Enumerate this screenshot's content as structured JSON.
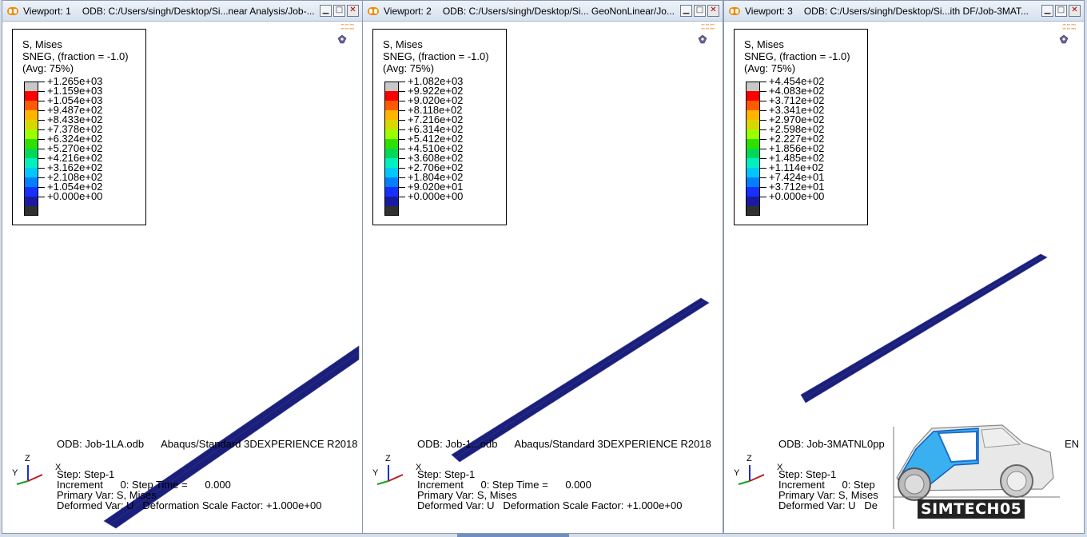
{
  "colors": {
    "scale": [
      "#c8c8c8",
      "#ff0000",
      "#ff5a00",
      "#ffb400",
      "#d8d800",
      "#9cff00",
      "#2ee000",
      "#00d85a",
      "#00f0c0",
      "#00c8ff",
      "#0080ff",
      "#1830ff",
      "#1a1aa0",
      "#303030"
    ],
    "mesh": "#1b1f7a",
    "mesh_line": "#3a4aa8"
  },
  "viewports": [
    {
      "title": "Viewport: 1",
      "odb_path": "ODB: C:/Users/singh/Desktop/Si...near Analysis/Job-...",
      "legend": {
        "header": [
          "S, Mises",
          "SNEG, (fraction = -1.0)",
          "(Avg: 75%)"
        ],
        "values": [
          "+1.265e+03",
          "+1.159e+03",
          "+1.054e+03",
          "+9.487e+02",
          "+8.433e+02",
          "+7.378e+02",
          "+6.324e+02",
          "+5.270e+02",
          "+4.216e+02",
          "+3.162e+02",
          "+2.108e+02",
          "+1.054e+02",
          "+0.000e+00"
        ]
      },
      "info": {
        "odb_line": "ODB: Job-1LA.odb      Abaqus/Standard 3DEXPERIENCE R2018",
        "step": "Step: Step-1",
        "increment": "Increment      0: Step Time =      0.000",
        "primary": "Primary Var: S, Mises",
        "deformed": "Deformed Var: U   Deformation Scale Factor: +1.000e+00"
      }
    },
    {
      "title": "Viewport: 2",
      "odb_path": "ODB: C:/Users/singh/Desktop/Si... GeoNonLinear/Jo...",
      "legend": {
        "header": [
          "S, Mises",
          "SNEG, (fraction = -1.0)",
          "(Avg: 75%)"
        ],
        "values": [
          "+1.082e+03",
          "+9.922e+02",
          "+9.020e+02",
          "+8.118e+02",
          "+7.216e+02",
          "+6.314e+02",
          "+5.412e+02",
          "+4.510e+02",
          "+3.608e+02",
          "+2.706e+02",
          "+1.804e+02",
          "+9.020e+01",
          "+0.000e+00"
        ]
      },
      "info": {
        "odb_line": "ODB: Job-1...odb      Abaqus/Standard 3DEXPERIENCE R2018",
        "step": "Step: Step-1",
        "increment": "Increment      0: Step Time =      0.000",
        "primary": "Primary Var: S, Mises",
        "deformed": "Deformed Var: U   Deformation Scale Factor: +1.000e+00"
      }
    },
    {
      "title": "Viewport: 3",
      "odb_path": "ODB: C:/Users/singh/Desktop/Si...ith DF/Job-3MAT...",
      "legend": {
        "header": [
          "S, Mises",
          "SNEG, (fraction = -1.0)",
          "(Avg: 75%)"
        ],
        "values": [
          "+4.454e+02",
          "+4.083e+02",
          "+3.712e+02",
          "+3.341e+02",
          "+2.970e+02",
          "+2.598e+02",
          "+2.227e+02",
          "+1.856e+02",
          "+1.485e+02",
          "+1.114e+02",
          "+7.424e+01",
          "+3.712e+01",
          "+0.000e+00"
        ]
      },
      "info": {
        "odb_line": "ODB: Job-3MATNL0pp",
        "odb_line_tail": "EN",
        "step": "Step: Step-1",
        "increment": "Increment      0: Step",
        "primary": "Primary Var: S, Mises",
        "deformed": "Deformed Var: U   De"
      }
    }
  ],
  "triad": {
    "z": "Z",
    "y": "Y",
    "x": "X"
  },
  "watermark": {
    "text": "SIMTECH05",
    "icon": "car-body-icon"
  },
  "window_buttons": [
    "minimize",
    "maximize",
    "close"
  ]
}
